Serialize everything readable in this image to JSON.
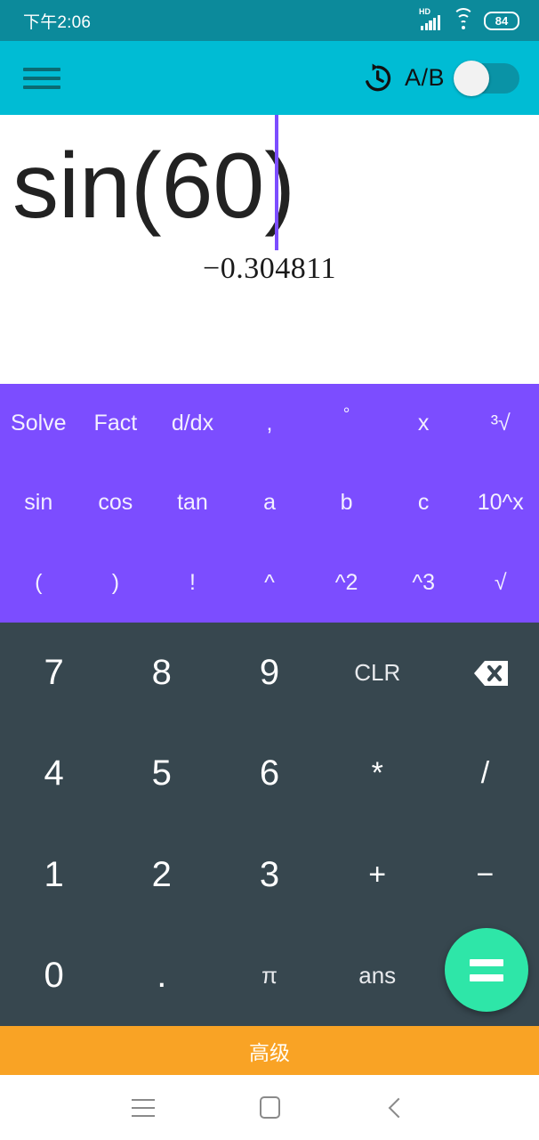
{
  "status_bar": {
    "clock": "下午2:06",
    "network_type": "HD",
    "signal_icon": "signal-bars-icon",
    "wifi_icon": "wifi-icon",
    "battery_level": "84"
  },
  "app_bar": {
    "menu_icon": "hamburger-menu-icon",
    "history_icon": "history-clock-icon",
    "ab_toggle_label": "A/B",
    "ab_toggle_state": "off"
  },
  "display": {
    "expression": "sin(60)",
    "expression_prefix": "sin(60",
    "expression_suffix": ")",
    "result": "−0.304811",
    "cursor_visible": true
  },
  "function_pad": {
    "accent_color": "#7C4DFF",
    "rows": [
      [
        {
          "label": "Solve",
          "name": "solve"
        },
        {
          "label": "Fact",
          "name": "fact"
        },
        {
          "label": "d/dx",
          "name": "ddx"
        },
        {
          "label": ",",
          "name": "comma"
        },
        {
          "label": "°",
          "name": "degree"
        },
        {
          "label": "x",
          "name": "variable-x"
        },
        {
          "label": "³√",
          "name": "cube-root"
        }
      ],
      [
        {
          "label": "sin",
          "name": "sin"
        },
        {
          "label": "cos",
          "name": "cos"
        },
        {
          "label": "tan",
          "name": "tan"
        },
        {
          "label": "a",
          "name": "variable-a"
        },
        {
          "label": "b",
          "name": "variable-b"
        },
        {
          "label": "c",
          "name": "variable-c"
        },
        {
          "label": "10^x",
          "name": "ten-power-x"
        }
      ],
      [
        {
          "label": "(",
          "name": "open-paren"
        },
        {
          "label": ")",
          "name": "close-paren"
        },
        {
          "label": "!",
          "name": "factorial"
        },
        {
          "label": "^",
          "name": "power"
        },
        {
          "label": "^2",
          "name": "square"
        },
        {
          "label": "^3",
          "name": "cube"
        },
        {
          "label": "√",
          "name": "square-root"
        }
      ]
    ]
  },
  "number_pad": {
    "background_color": "#37474F",
    "rows": [
      [
        {
          "label": "7",
          "name": "digit-7"
        },
        {
          "label": "8",
          "name": "digit-8"
        },
        {
          "label": "9",
          "name": "digit-9"
        },
        {
          "label": "CLR",
          "name": "clear"
        },
        {
          "label": "",
          "name": "backspace-icon"
        }
      ],
      [
        {
          "label": "4",
          "name": "digit-4"
        },
        {
          "label": "5",
          "name": "digit-5"
        },
        {
          "label": "6",
          "name": "digit-6"
        },
        {
          "label": "*",
          "name": "multiply"
        },
        {
          "label": "/",
          "name": "divide"
        }
      ],
      [
        {
          "label": "1",
          "name": "digit-1"
        },
        {
          "label": "2",
          "name": "digit-2"
        },
        {
          "label": "3",
          "name": "digit-3"
        },
        {
          "label": "+",
          "name": "plus"
        },
        {
          "label": "−",
          "name": "minus"
        }
      ],
      [
        {
          "label": "0",
          "name": "digit-0"
        },
        {
          "label": ".",
          "name": "decimal-point"
        },
        {
          "label": "π",
          "name": "pi"
        },
        {
          "label": "ans",
          "name": "answer"
        },
        {
          "label": "",
          "name": "equals-spacer"
        }
      ]
    ],
    "equals_button": {
      "label": "=",
      "color": "#2EE6A8"
    }
  },
  "advanced_bar": {
    "label": "高级",
    "color": "#F9A325"
  },
  "nav_bar": {
    "recents_icon": "recents-icon",
    "home_icon": "home-icon",
    "back_icon": "back-icon"
  }
}
